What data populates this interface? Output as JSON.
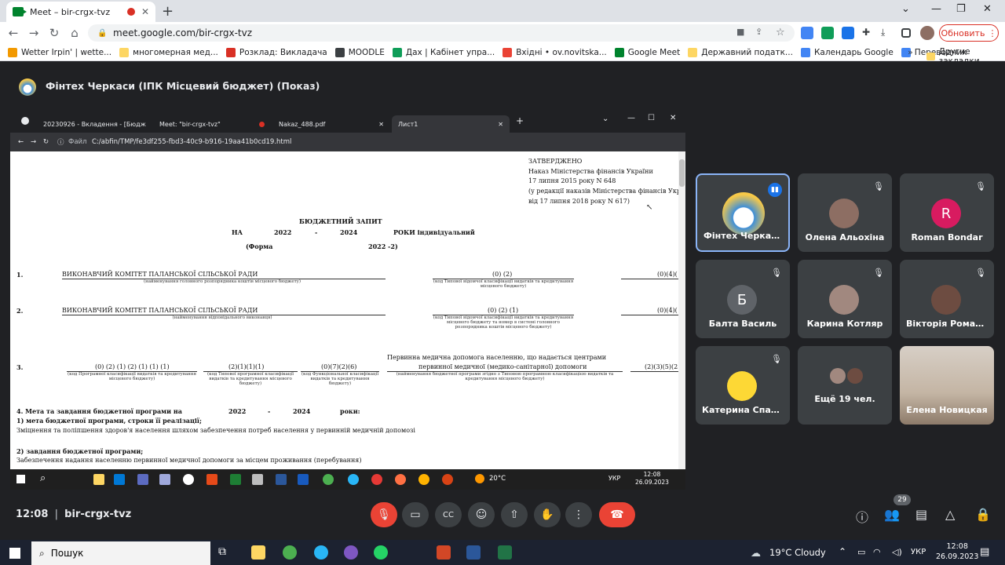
{
  "browser": {
    "tab_title": "Meet – bir-crgx-tvz",
    "url": "meet.google.com/bir-crgx-tvz",
    "update_button": "Обновить",
    "bookmarks": [
      {
        "label": "Wetter Irpin' | wette...",
        "color": "#f29900"
      },
      {
        "label": "многомерная мед...",
        "color": "#fdd663"
      },
      {
        "label": "Розклад: Викладача",
        "color": "#d93025"
      },
      {
        "label": "MOODLE",
        "color": "#3c4043"
      },
      {
        "label": "Дах | Кабінет упра...",
        "color": "#0f9d58"
      },
      {
        "label": "Вхідні • ov.novitska...",
        "color": "#ea4335"
      },
      {
        "label": "Google Meet",
        "color": "#00832d"
      },
      {
        "label": "Державний податк...",
        "color": "#fdd663"
      },
      {
        "label": "Календарь Google",
        "color": "#4285f4"
      },
      {
        "label": "Переводчик",
        "color": "#4285f4"
      }
    ],
    "other_bookmarks": "Другие закладки"
  },
  "meeting": {
    "presenter_title": "Фінтех Черкаси (ІПК Місцевий бюджет) (Показ)",
    "time": "12:08",
    "code": "bir-crgx-tvz",
    "participants_count": "29"
  },
  "shared_screen": {
    "tabs": [
      "20230926 - Вкладення - [Бюдж",
      "Meet: \"bir-crgx-tvz\"",
      "Nakaz_488.pdf",
      "Лист1"
    ],
    "file_label": "Файл",
    "path": "C:/abfin/TMP/fe3df255-fbd3-40c9-b916-19aa41b0cd19.html",
    "doc": {
      "approved": "ЗАТВЕРДЖЕНО",
      "approved_l1": "Наказ Міністерства фінансів України",
      "approved_l2": "17 липня 2015 року N 648",
      "approved_l3": "(у редакції наказів Міністерства фінансів України",
      "approved_l4": "від 17 липня 2018 року N 617)",
      "title": "БЮДЖЕТНИЙ ЗАПИТ",
      "na": "НА",
      "year_from": "2022",
      "dash": "-",
      "year_to": "2024",
      "roky": "РОКИ індивідуальний",
      "form": "(Форма",
      "form_code": "2022  -2)",
      "row1_num": "1.",
      "row1_org": "ВИКОНАВЧИЙ КОМІТЕТ ПАЛАНСЬКОЇ СІЛЬСЬКОЇ РАДИ",
      "row1_caption": "(найменування головного розпорядника коштів місцевого бюджету)",
      "row1_code": "(0) (2)",
      "row1_code_caption": "(код Типової відомчої класифікації видатків та кредитування місцевого бюджету)",
      "row1_right": "(0)(4)(",
      "row2_num": "2.",
      "row2_org": "ВИКОНАВЧИЙ КОМІТЕТ ПАЛАНСЬКОЇ СІЛЬСЬКОЇ РАДИ",
      "row2_caption": "(найменування відповідального виконавця)",
      "row2_code": "(0) (2) (1)",
      "row2_code_caption": "(код Типової відомчої класифікації видатків та кредитування місцевого бюджету та номер в системі головного розпорядника коштів місцевого бюджету)",
      "row2_right": "(0)(4)(",
      "row3_num": "3.",
      "row3_c1": "(0) (2) (1) (2) (1) (1) (1)",
      "row3_c1_caption": "(код Програмної класифікації видатків та кредитування місцевого бюджету)",
      "row3_c2": "(2)(1)(1)(1)",
      "row3_c2_caption": "(код Типової програмної класифікації видатків та кредитування місцевого бюджету)",
      "row3_c3": "(0)(7)(2)(6)",
      "row3_c3_caption": "(код Функціональної класифікації видатків та кредитування бюджету)",
      "row3_desc_l1": "Первинна медична допомога населенню, що надається центрами",
      "row3_desc_l2": "первинної медичної (медико-санітарної) допомоги",
      "row3_desc_caption": "(найменування бюджетної програми згідно з Типовою програмною класифікацією видатків та кредитування місцевого бюджету)",
      "row3_right": "(2)(3)(5)(2",
      "sec4_title": "4. Мета та завдання бюджетної програми на",
      "sec4_from": "2022",
      "sec4_dash": "-",
      "sec4_to": "2024",
      "sec4_roky": "роки:",
      "sec4_1": "1) мета бюджетної програми, строки її реалізації;",
      "sec4_1_text": "Зміцнення та поліпшення здоров'я населення шляхом забезпечення потреб населення у первинній медичній допомозі",
      "sec4_2": "2) завдання бюджетної програми;",
      "sec4_2_text": "Забезпечення надання населенню первинної медичної допомоги за місцем проживання (перебування)"
    },
    "taskbar": {
      "temp": "20°C",
      "lang": "УКР",
      "time": "12:08",
      "date": "26.09.2023"
    }
  },
  "tiles": [
    {
      "name": "Фінтех Черкаси...",
      "initial": "",
      "color": "#f7c948",
      "speaking": true
    },
    {
      "name": "Олена Альохіна",
      "initial": "",
      "color": "#8d6e63",
      "speaking": false
    },
    {
      "name": "Roman Bondar",
      "initial": "R",
      "color": "#d81b60",
      "speaking": false
    },
    {
      "name": "Балта Василь",
      "initial": "Б",
      "color": "#5f6368",
      "speaking": false
    },
    {
      "name": "Карина Котляр",
      "initial": "",
      "color": "#a1887f",
      "speaking": false
    },
    {
      "name": "Вікторія Роман...",
      "initial": "",
      "color": "#6d4c41",
      "speaking": false
    },
    {
      "name": "Катерина Спан...",
      "initial": "",
      "color": "#fdd835",
      "speaking": false
    },
    {
      "name": "Ещё 19 чел.",
      "initial": "",
      "color": "#795548",
      "speaking": false
    },
    {
      "name": "Елена Новицкая",
      "initial": "",
      "color": "#c9b8a6",
      "speaking": false
    }
  ],
  "windows": {
    "search": "Пошук",
    "weather": "19°C  Cloudy",
    "lang": "УКР",
    "time": "12:08",
    "date": "26.09.2023"
  }
}
